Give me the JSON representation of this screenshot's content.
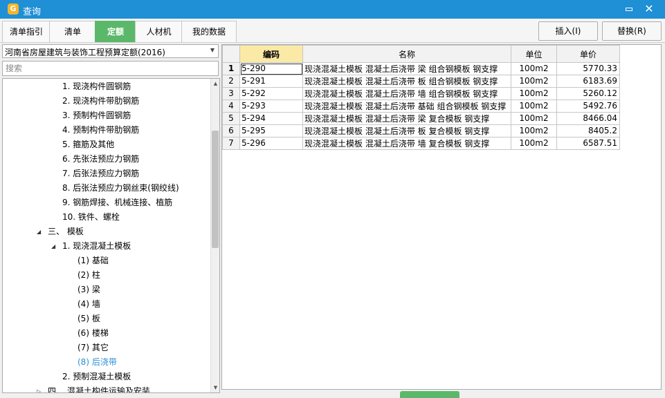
{
  "window": {
    "title": "查询",
    "app_icon_glyph": "G",
    "close_glyph": "✕"
  },
  "tabs": [
    "清单指引",
    "清单",
    "定额",
    "人材机",
    "我的数据"
  ],
  "active_tab_index": 2,
  "toolbar": {
    "insert_label": "插入(I)",
    "replace_label": "替换(R)"
  },
  "dataset": {
    "selected": "河南省房屋建筑与装饰工程预算定额(2016)"
  },
  "search": {
    "placeholder": "搜索",
    "value": ""
  },
  "tree": {
    "items": [
      {
        "label": "1. 现浇构件圆钢筋",
        "level": 2,
        "expander": ""
      },
      {
        "label": "2. 现浇构件带肋钢筋",
        "level": 2,
        "expander": ""
      },
      {
        "label": "3. 预制构件圆钢筋",
        "level": 2,
        "expander": ""
      },
      {
        "label": "4. 预制构件带肋钢筋",
        "level": 2,
        "expander": ""
      },
      {
        "label": "5. 箍筋及其他",
        "level": 2,
        "expander": ""
      },
      {
        "label": "6. 先张法预应力钢筋",
        "level": 2,
        "expander": ""
      },
      {
        "label": "7. 后张法预应力钢筋",
        "level": 2,
        "expander": ""
      },
      {
        "label": "8. 后张法预应力钢丝束(钢绞线)",
        "level": 2,
        "expander": ""
      },
      {
        "label": "9. 钢筋焊接、机械连接、植筋",
        "level": 2,
        "expander": ""
      },
      {
        "label": "10. 铁件、螺栓",
        "level": 2,
        "expander": ""
      },
      {
        "label": "三、 模板",
        "level": 1,
        "expander": "◢"
      },
      {
        "label": "1. 现浇混凝土模板",
        "level": 2,
        "expander": "◢"
      },
      {
        "label": "(1) 基础",
        "level": 3,
        "expander": ""
      },
      {
        "label": "(2) 柱",
        "level": 3,
        "expander": ""
      },
      {
        "label": "(3) 梁",
        "level": 3,
        "expander": ""
      },
      {
        "label": "(4) 墙",
        "level": 3,
        "expander": ""
      },
      {
        "label": "(5) 板",
        "level": 3,
        "expander": ""
      },
      {
        "label": "(6) 楼梯",
        "level": 3,
        "expander": ""
      },
      {
        "label": "(7) 其它",
        "level": 3,
        "expander": ""
      },
      {
        "label": "(8) 后浇带",
        "level": 3,
        "expander": "",
        "selected": true
      },
      {
        "label": "2. 预制混凝土模板",
        "level": 2,
        "expander": ""
      },
      {
        "label": "四、 混凝土构件运输及安装",
        "level": 1,
        "expander": "▷"
      }
    ]
  },
  "table": {
    "columns": [
      "编码",
      "名称",
      "单位",
      "单价"
    ],
    "highlight_column_index": 0,
    "current_row_index": 0,
    "rows": [
      {
        "num": "1",
        "code": "5-290",
        "name": "现浇混凝土模板 混凝土后浇带 梁 组合钢模板 钢支撑",
        "unit": "100m2",
        "price": "5770.33"
      },
      {
        "num": "2",
        "code": "5-291",
        "name": "现浇混凝土模板 混凝土后浇带 板 组合钢模板 钢支撑",
        "unit": "100m2",
        "price": "6183.69"
      },
      {
        "num": "3",
        "code": "5-292",
        "name": "现浇混凝土模板 混凝土后浇带 墙 组合钢模板 钢支撑",
        "unit": "100m2",
        "price": "5260.12"
      },
      {
        "num": "4",
        "code": "5-293",
        "name": "现浇混凝土模板 混凝土后浇带 基础 组合钢模板 钢支撑",
        "unit": "100m2",
        "price": "5492.76"
      },
      {
        "num": "5",
        "code": "5-294",
        "name": "现浇混凝土模板 混凝土后浇带 梁 复合模板 钢支撑",
        "unit": "100m2",
        "price": "8466.04"
      },
      {
        "num": "6",
        "code": "5-295",
        "name": "现浇混凝土模板 混凝土后浇带 板 复合模板 钢支撑",
        "unit": "100m2",
        "price": "8405.2"
      },
      {
        "num": "7",
        "code": "5-296",
        "name": "现浇混凝土模板 混凝土后浇带 墙 复合模板 钢支撑",
        "unit": "100m2",
        "price": "6587.51"
      }
    ]
  },
  "colors": {
    "titlebar": "#1f8fd6",
    "active_tab": "#5bb86a",
    "selected_tree": "#2a8ed8",
    "header_highlight": "#fbe9a6"
  }
}
